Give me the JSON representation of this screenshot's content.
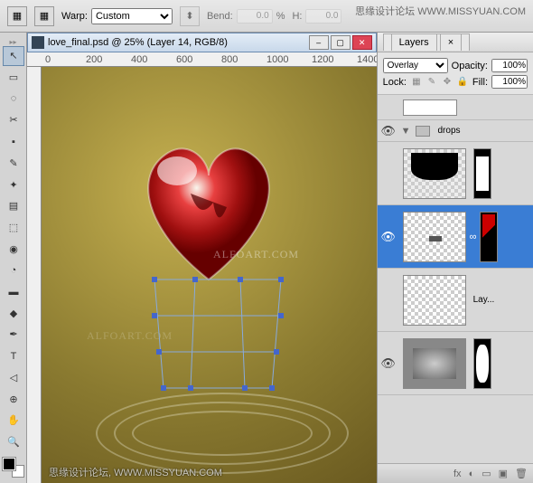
{
  "topbar": {
    "warp_label": "Warp:",
    "warp_value": "Custom",
    "bend_label": "Bend:",
    "bend_value": "0.0",
    "pct": "%",
    "h_label": "H:",
    "h_value": "0.0"
  },
  "watermarks": {
    "top": "思缘设计论坛 WWW.MISSYUAN.COM",
    "bottom": "思缘设计论坛, WWW.MISSYUAN.COM",
    "alfo1": "ALFOART.COM",
    "alfo2": "ALFOART.COM"
  },
  "document": {
    "title": "love_final.psd @ 25% (Layer 14, RGB/8)",
    "ruler_marks": [
      "0",
      "200",
      "400",
      "600",
      "800",
      "1000",
      "1200",
      "1400"
    ]
  },
  "layers": {
    "tab_label": "Layers",
    "close_x": "×",
    "blend_mode": "Overlay",
    "opacity_label": "Opacity:",
    "opacity_value": "100%",
    "lock_label": "Lock:",
    "fill_label": "Fill:",
    "fill_value": "100%",
    "group_name": "drops",
    "layer_ellipsis": "Lay...",
    "footer_icons": [
      "fx",
      "◐",
      "▭",
      "▣",
      "🗑"
    ]
  },
  "tools": [
    "↖",
    "▭",
    "◌",
    "✂",
    "▪",
    "✎",
    "✦",
    "▤",
    "⬚",
    "◉",
    "◔",
    "▬",
    "◆",
    "✒",
    "T",
    "◁",
    "⊕",
    "✋",
    "🔍"
  ]
}
